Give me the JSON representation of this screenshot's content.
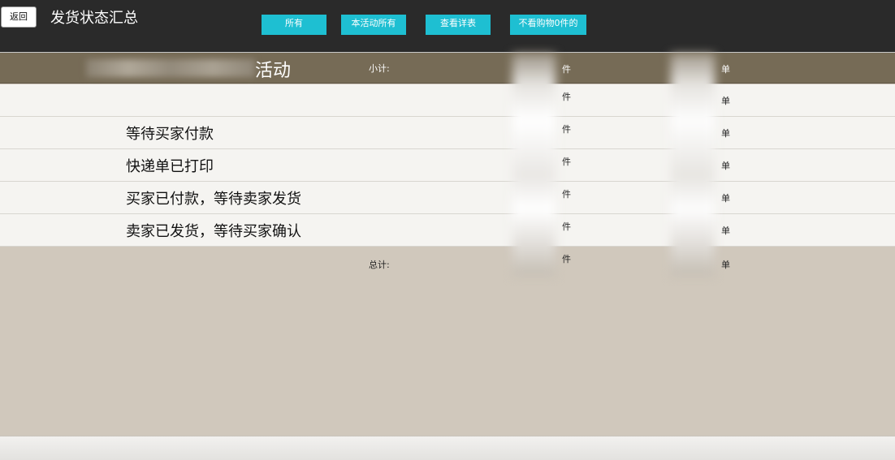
{
  "header": {
    "back_label": "返回",
    "title": "发货状态汇总",
    "filters": [
      "所有",
      "本活动所有",
      "查看详表",
      "不看购物0件的"
    ]
  },
  "summary": {
    "activity_suffix": "活动",
    "subtotal_label": "小计:",
    "qty_unit": "件",
    "order_unit": "单"
  },
  "rows": [
    {
      "status": "",
      "qty_unit": "件",
      "order_unit": "单"
    },
    {
      "status": "等待买家付款",
      "qty_unit": "件",
      "order_unit": "单"
    },
    {
      "status": "快递单已打印",
      "qty_unit": "件",
      "order_unit": "单"
    },
    {
      "status": "买家已付款，等待卖家发货",
      "qty_unit": "件",
      "order_unit": "单"
    },
    {
      "status": "卖家已发货，等待买家确认",
      "qty_unit": "件",
      "order_unit": "单"
    }
  ],
  "total": {
    "label": "总计:",
    "qty_unit": "件",
    "order_unit": "单"
  }
}
